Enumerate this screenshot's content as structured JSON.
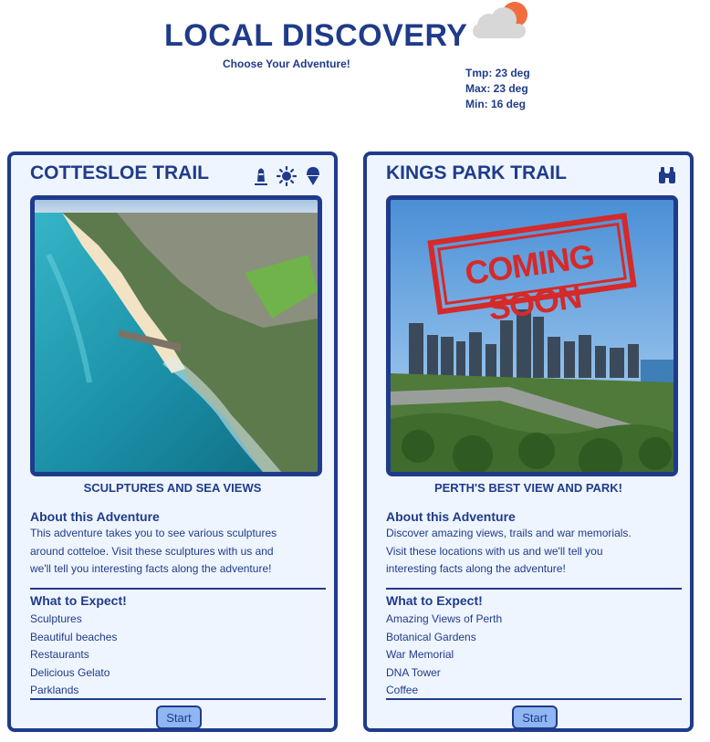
{
  "header": {
    "title": "LOCAL DISCOVERY",
    "subtitle": "Choose Your Adventure!",
    "weather": {
      "icon": "cloud-sun-icon",
      "temp": "Tmp: 23 deg",
      "max": "Max: 23 deg",
      "min": "Min: 16 deg"
    }
  },
  "trails": [
    {
      "title": "COTTESLOE TRAIL",
      "icons": [
        "lighthouse-icon",
        "sun-icon",
        "ice-cream-icon"
      ],
      "image": "aerial-beach-photo",
      "tagline": "SCULPTURES AND SEA VIEWS",
      "about_heading": "About this Adventure",
      "about_lines": [
        "This adventure takes you to see various sculptures",
        "around cotteloe. Visit these sculptures with us and",
        "we'll tell you interesting facts along the adventure!"
      ],
      "expect_heading": "What to Expect!",
      "expect_items": [
        "Sculptures",
        "Beautiful beaches",
        "Restaurants",
        "Delicious Gelato",
        "Parklands"
      ],
      "button": "Start"
    },
    {
      "title": "KINGS PARK TRAIL",
      "icons": [
        "binoculars-icon"
      ],
      "image": "city-skyline-photo",
      "stamp": "COMING SOON",
      "tagline": "PERTH'S BEST VIEW AND PARK!",
      "about_heading": "About this Adventure",
      "about_lines": [
        "Discover amazing views, trails and war memorials.",
        "Visit these locations with us and we'll tell you",
        "interesting facts along the adventure!"
      ],
      "expect_heading": "What to Expect!",
      "expect_items": [
        "Amazing Views of Perth",
        "Botanical Gardens",
        "War Memorial",
        "DNA Tower",
        "Coffee"
      ],
      "button": "Start"
    }
  ],
  "colors": {
    "primary": "#1f3b8a",
    "card_background": "#eff5ff",
    "button_fill": "#8fb6f2",
    "stamp_red": "#d42a2a"
  }
}
